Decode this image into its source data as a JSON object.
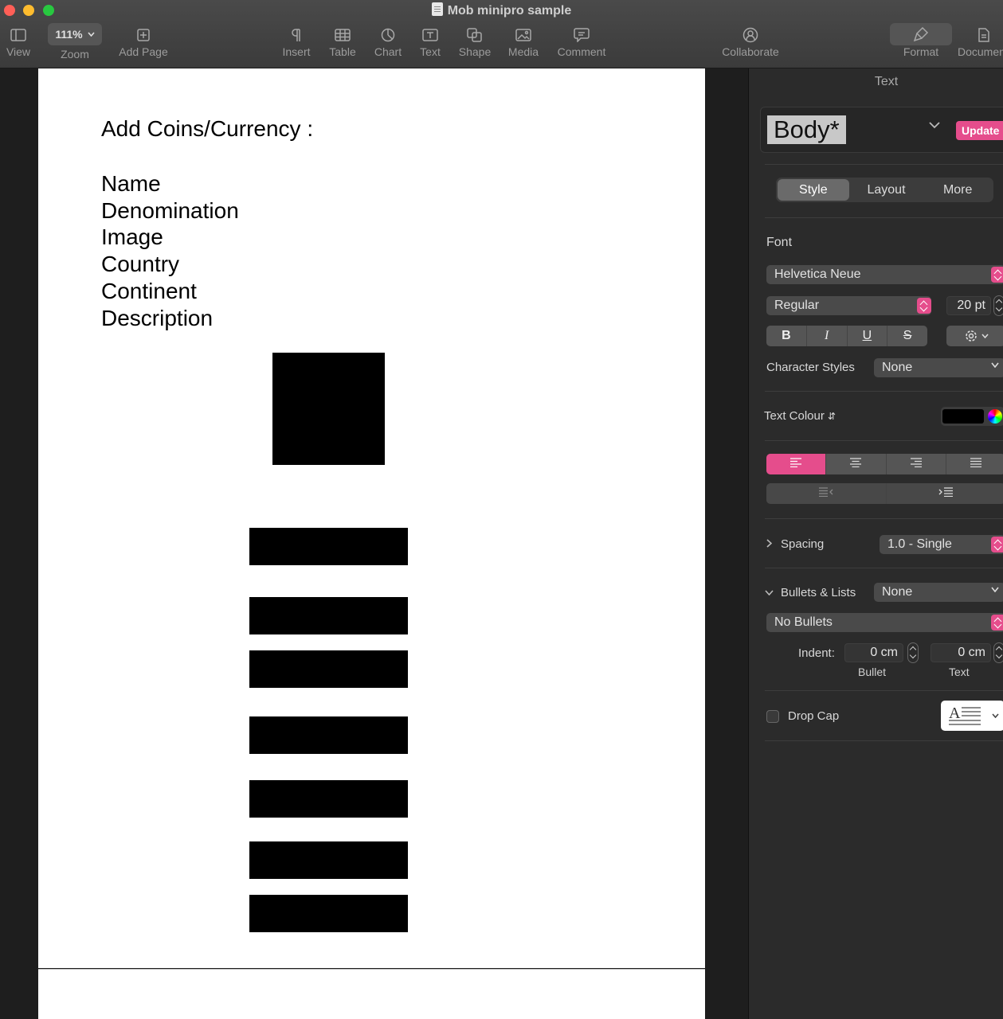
{
  "window": {
    "title": "Mob minipro sample"
  },
  "toolbar": {
    "view": "View",
    "zoom_value": "111%",
    "zoom": "Zoom",
    "add_page": "Add Page",
    "insert": "Insert",
    "table": "Table",
    "chart": "Chart",
    "text": "Text",
    "shape": "Shape",
    "media": "Media",
    "comment": "Comment",
    "collaborate": "Collaborate",
    "format": "Format",
    "document": "Document"
  },
  "document": {
    "heading": "Add Coins/Currency :",
    "fields": [
      "Name",
      "Denomination",
      "Image",
      "Country",
      "Continent",
      "Description"
    ]
  },
  "sidebar": {
    "section_title": "Text",
    "paragraph_style": "Body*",
    "update_label": "Update",
    "tabs": [
      "Style",
      "Layout",
      "More"
    ],
    "font_label": "Font",
    "font_family": "Helvetica Neue",
    "font_typeface": "Regular",
    "font_size": "20 pt",
    "format_buttons": [
      "B",
      "I",
      "U",
      "S"
    ],
    "character_styles_label": "Character Styles",
    "character_styles_value": "None",
    "text_colour_label": "Text Colour",
    "text_colour_value": "#000000",
    "alignment_selected": "left",
    "spacing_label": "Spacing",
    "spacing_value": "1.0 - Single",
    "bullets_label": "Bullets & Lists",
    "bullets_value": "None",
    "bullet_type": "No Bullets",
    "indent_label": "Indent:",
    "indent_bullet_value": "0 cm",
    "indent_text_value": "0 cm",
    "indent_bullet_caption": "Bullet",
    "indent_text_caption": "Text",
    "drop_cap_label": "Drop Cap",
    "drop_cap_checked": false
  }
}
